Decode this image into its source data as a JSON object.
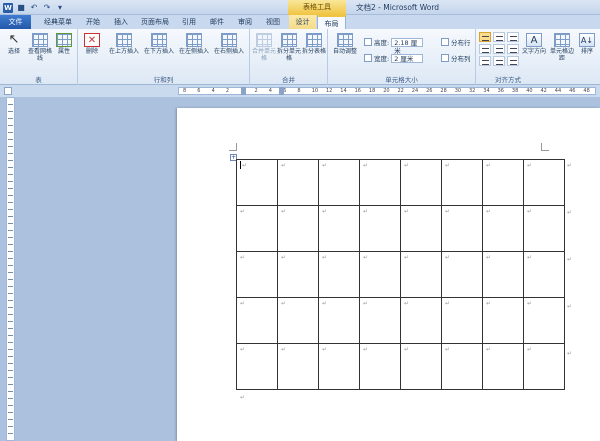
{
  "titlebar": {
    "context_tool": "表格工具",
    "window_title": "文档2 - Microsoft Word",
    "app_icon_label": "W",
    "quick_access": [
      "save-icon",
      "undo-icon",
      "redo-icon",
      "customize-icon"
    ]
  },
  "tabs": [
    {
      "label": "文件",
      "kind": "file"
    },
    {
      "label": "经典菜单",
      "kind": "normal"
    },
    {
      "label": "开始",
      "kind": "normal"
    },
    {
      "label": "插入",
      "kind": "normal"
    },
    {
      "label": "页面布局",
      "kind": "normal"
    },
    {
      "label": "引用",
      "kind": "normal"
    },
    {
      "label": "邮件",
      "kind": "normal"
    },
    {
      "label": "审阅",
      "kind": "normal"
    },
    {
      "label": "视图",
      "kind": "normal"
    },
    {
      "label": "设计",
      "kind": "context"
    },
    {
      "label": "布局",
      "kind": "context-active"
    }
  ],
  "ribbon": {
    "groups": {
      "table": "表",
      "rows_cols": "行和列",
      "merge": "合并",
      "cell_size": "单元格大小",
      "alignment": "对齐方式"
    },
    "buttons": {
      "select": "选择",
      "view_gridlines": "查看网格线",
      "properties": "属性",
      "delete": "删除",
      "insert_above": "在上方插入",
      "insert_below": "在下方插入",
      "insert_left": "在左侧插入",
      "insert_right": "在右侧插入",
      "merge_cells": "合并单元格",
      "split_cells": "拆分单元格",
      "split_table": "拆分表格",
      "autofit": "自动调整",
      "distribute_rows": "分布行",
      "distribute_cols": "分布列",
      "text_direction": "文字方向",
      "cell_margins": "单元格边距",
      "sort": "排序"
    },
    "cell_size": {
      "height_label": "高度:",
      "height_value": "2.18 厘米",
      "width_label": "宽度:",
      "width_value": "2 厘米"
    }
  },
  "ruler": {
    "ticks": [
      "8",
      "6",
      "4",
      "2",
      "",
      "2",
      "4",
      "6",
      "8",
      "10",
      "12",
      "14",
      "16",
      "18",
      "20",
      "22",
      "24",
      "26",
      "28",
      "30",
      "32",
      "34",
      "36",
      "38",
      "40",
      "42",
      "44",
      "46",
      "48"
    ]
  },
  "document": {
    "table": {
      "rows": 5,
      "cols": 8
    },
    "paragraph_mark": "↵",
    "handle_glyph": "+"
  }
}
